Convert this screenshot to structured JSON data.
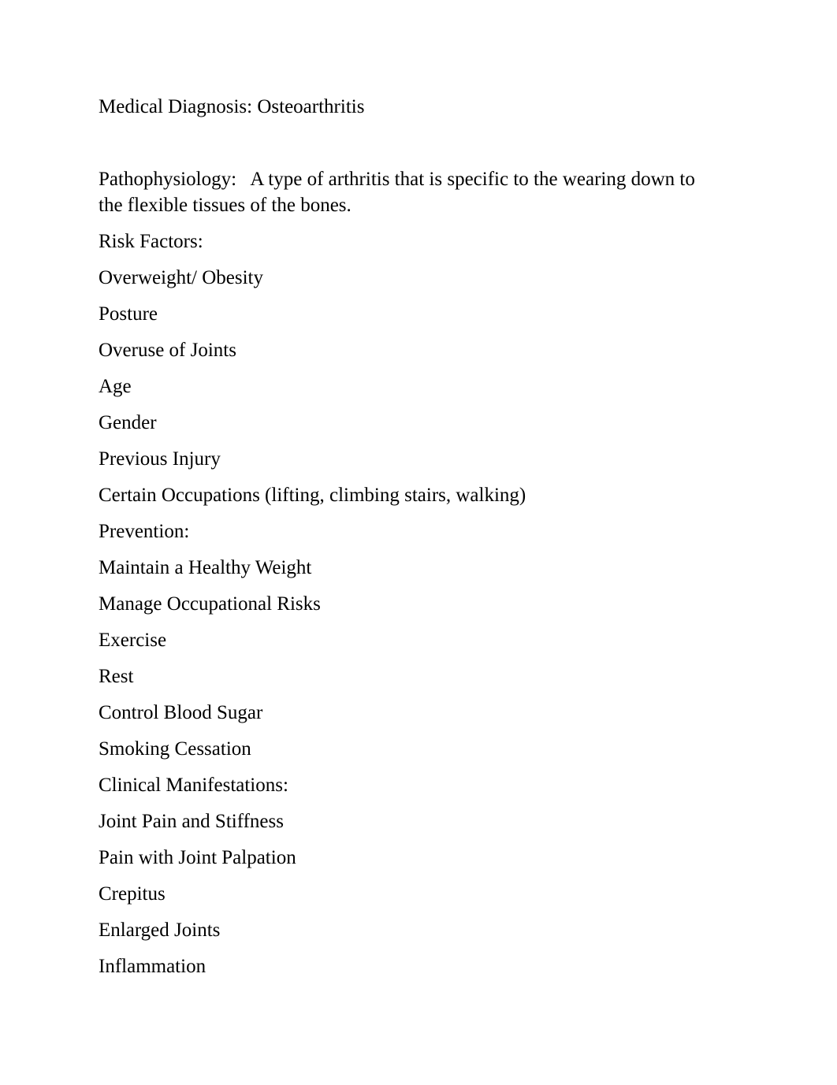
{
  "document": {
    "title_line": "Medical Diagnosis: Osteoarthritis",
    "blank_line": "",
    "pathophysiology": "Pathophysiology:   A type of arthritis that is specific to the wearing down to the flexible tissues of the bones.",
    "sections": [
      {
        "heading": "Risk Factors:",
        "items": [
          "Overweight/ Obesity",
          "Posture",
          "Overuse of Joints",
          "Age",
          "Gender",
          "Previous Injury",
          "Certain Occupations (lifting, climbing stairs, walking)"
        ]
      },
      {
        "heading": "Prevention:",
        "items": [
          "Maintain a Healthy Weight",
          "Manage Occupational Risks",
          "Exercise",
          "Rest",
          "Control Blood Sugar",
          "Smoking Cessation"
        ]
      },
      {
        "heading": "Clinical Manifestations:",
        "items": [
          "Joint Pain and Stiffness",
          "Pain with Joint Palpation",
          "Crepitus",
          "Enlarged Joints",
          "Inflammation"
        ]
      }
    ]
  }
}
